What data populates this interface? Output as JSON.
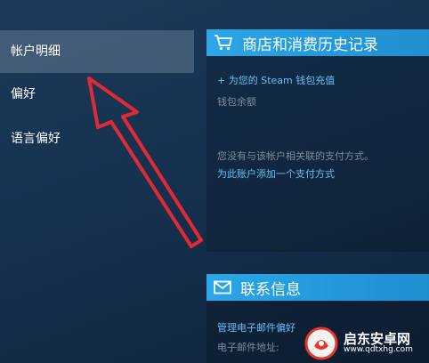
{
  "sidebar": {
    "items": [
      {
        "label": "帐户明细",
        "active": true
      },
      {
        "label": "偏好",
        "active": false
      },
      {
        "label": "语言偏好",
        "active": false
      }
    ]
  },
  "store_panel": {
    "title": "商店和消费历史记录",
    "icon": "cart-icon",
    "add_funds_link": "+ 为您的 Steam 钱包充值",
    "wallet_balance_label": "钱包余额",
    "no_payment_text": "您没有与该帐户相关联的支付方式。",
    "add_payment_link": "为此账户添加一个支付方式"
  },
  "contact_panel": {
    "title": "联系信息",
    "icon": "mail-icon",
    "manage_email_link": "管理电子邮件偏好",
    "email_label": "电子邮件地址:"
  },
  "watermark": {
    "brand": "启东安卓网",
    "url": "www.qdtxhg.com"
  },
  "colors": {
    "accent": "#1f8fd0",
    "link": "#66c0f4",
    "annotation": "#e02a35"
  }
}
